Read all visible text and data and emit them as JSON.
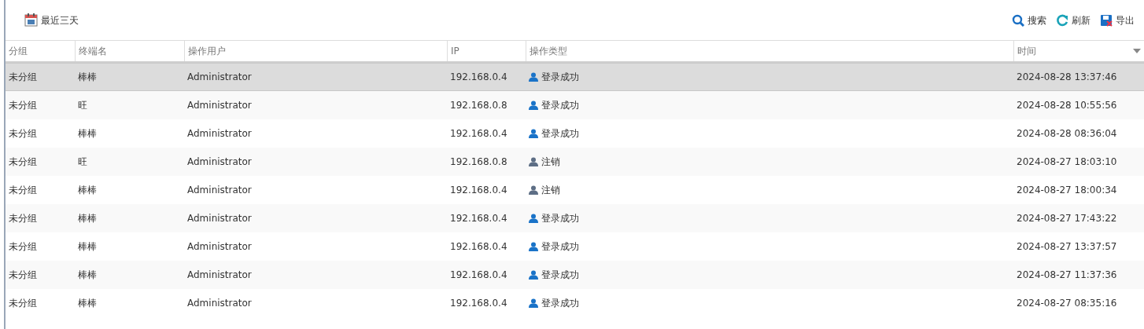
{
  "toolbar": {
    "date_range": "最近三天",
    "actions": [
      {
        "kind": "search",
        "label": "搜索"
      },
      {
        "kind": "refresh",
        "label": "刷新"
      },
      {
        "kind": "export",
        "label": "导出"
      }
    ]
  },
  "table": {
    "columns": [
      "分组",
      "终端名",
      "操作用户",
      "IP",
      "操作类型",
      "时间"
    ],
    "rows": [
      {
        "selected": true,
        "cells": [
          "未分组",
          "棒棒",
          "Administrator",
          "192.168.0.4"
        ],
        "kind": "login",
        "action": "登录成功",
        "time": "2024-08-28 13:37:46"
      },
      {
        "selected": false,
        "cells": [
          "未分组",
          "旺",
          "Administrator",
          "192.168.0.8"
        ],
        "kind": "login",
        "action": "登录成功",
        "time": "2024-08-28 10:55:56"
      },
      {
        "selected": false,
        "cells": [
          "未分组",
          "棒棒",
          "Administrator",
          "192.168.0.4"
        ],
        "kind": "login",
        "action": "登录成功",
        "time": "2024-08-28 08:36:04"
      },
      {
        "selected": false,
        "cells": [
          "未分组",
          "旺",
          "Administrator",
          "192.168.0.8"
        ],
        "kind": "logout",
        "action": "注销",
        "time": "2024-08-27 18:03:10"
      },
      {
        "selected": false,
        "cells": [
          "未分组",
          "棒棒",
          "Administrator",
          "192.168.0.4"
        ],
        "kind": "logout",
        "action": "注销",
        "time": "2024-08-27 18:00:34"
      },
      {
        "selected": false,
        "cells": [
          "未分组",
          "棒棒",
          "Administrator",
          "192.168.0.4"
        ],
        "kind": "login",
        "action": "登录成功",
        "time": "2024-08-27 17:43:22"
      },
      {
        "selected": false,
        "cells": [
          "未分组",
          "棒棒",
          "Administrator",
          "192.168.0.4"
        ],
        "kind": "login",
        "action": "登录成功",
        "time": "2024-08-27 13:37:57"
      },
      {
        "selected": false,
        "cells": [
          "未分组",
          "棒棒",
          "Administrator",
          "192.168.0.4"
        ],
        "kind": "login",
        "action": "登录成功",
        "time": "2024-08-27 11:37:36"
      },
      {
        "selected": false,
        "cells": [
          "未分组",
          "棒棒",
          "Administrator",
          "192.168.0.4"
        ],
        "kind": "login",
        "action": "登录成功",
        "time": "2024-08-27 08:35:16"
      }
    ]
  }
}
